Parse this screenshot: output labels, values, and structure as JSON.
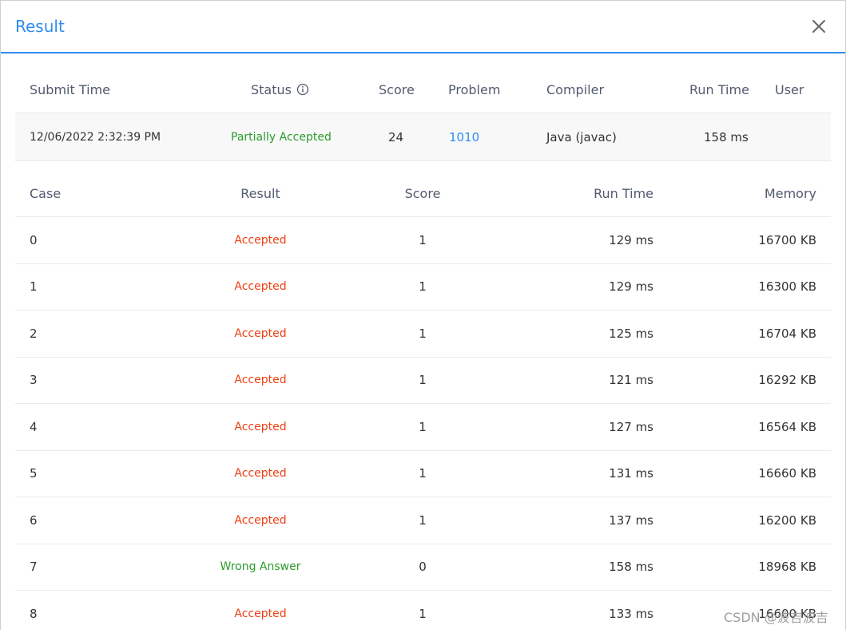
{
  "dialog": {
    "title": "Result"
  },
  "summary": {
    "headers": {
      "submit_time": "Submit Time",
      "status": "Status",
      "score": "Score",
      "problem": "Problem",
      "compiler": "Compiler",
      "run_time": "Run Time",
      "user": "User"
    },
    "row": {
      "submit_time": "12/06/2022 2:32:39 PM",
      "status": "Partially Accepted",
      "score": "24",
      "problem": "1010",
      "compiler": "Java (javac)",
      "run_time": "158 ms",
      "user": ""
    }
  },
  "cases": {
    "headers": {
      "case": "Case",
      "result": "Result",
      "score": "Score",
      "run_time": "Run Time",
      "memory": "Memory"
    },
    "rows": [
      {
        "case": "0",
        "result": "Accepted",
        "score": "1",
        "run_time": "129 ms",
        "memory": "16700 KB"
      },
      {
        "case": "1",
        "result": "Accepted",
        "score": "1",
        "run_time": "129 ms",
        "memory": "16300 KB"
      },
      {
        "case": "2",
        "result": "Accepted",
        "score": "1",
        "run_time": "125 ms",
        "memory": "16704 KB"
      },
      {
        "case": "3",
        "result": "Accepted",
        "score": "1",
        "run_time": "121 ms",
        "memory": "16292 KB"
      },
      {
        "case": "4",
        "result": "Accepted",
        "score": "1",
        "run_time": "127 ms",
        "memory": "16564 KB"
      },
      {
        "case": "5",
        "result": "Accepted",
        "score": "1",
        "run_time": "131 ms",
        "memory": "16660 KB"
      },
      {
        "case": "6",
        "result": "Accepted",
        "score": "1",
        "run_time": "137 ms",
        "memory": "16200 KB"
      },
      {
        "case": "7",
        "result": "Wrong Answer",
        "score": "0",
        "run_time": "158 ms",
        "memory": "18968 KB"
      },
      {
        "case": "8",
        "result": "Accepted",
        "score": "1",
        "run_time": "133 ms",
        "memory": "16600 KB"
      }
    ]
  },
  "watermark": "CSDN @波吉波吉",
  "colors": {
    "accent": "#2d8cf0",
    "accepted": "#ed4014",
    "wrong_answer": "#2a9c2a",
    "partially_accepted": "#2a9c2a"
  },
  "icons": {
    "close": "close-icon",
    "status_info": "info-circle-icon"
  }
}
